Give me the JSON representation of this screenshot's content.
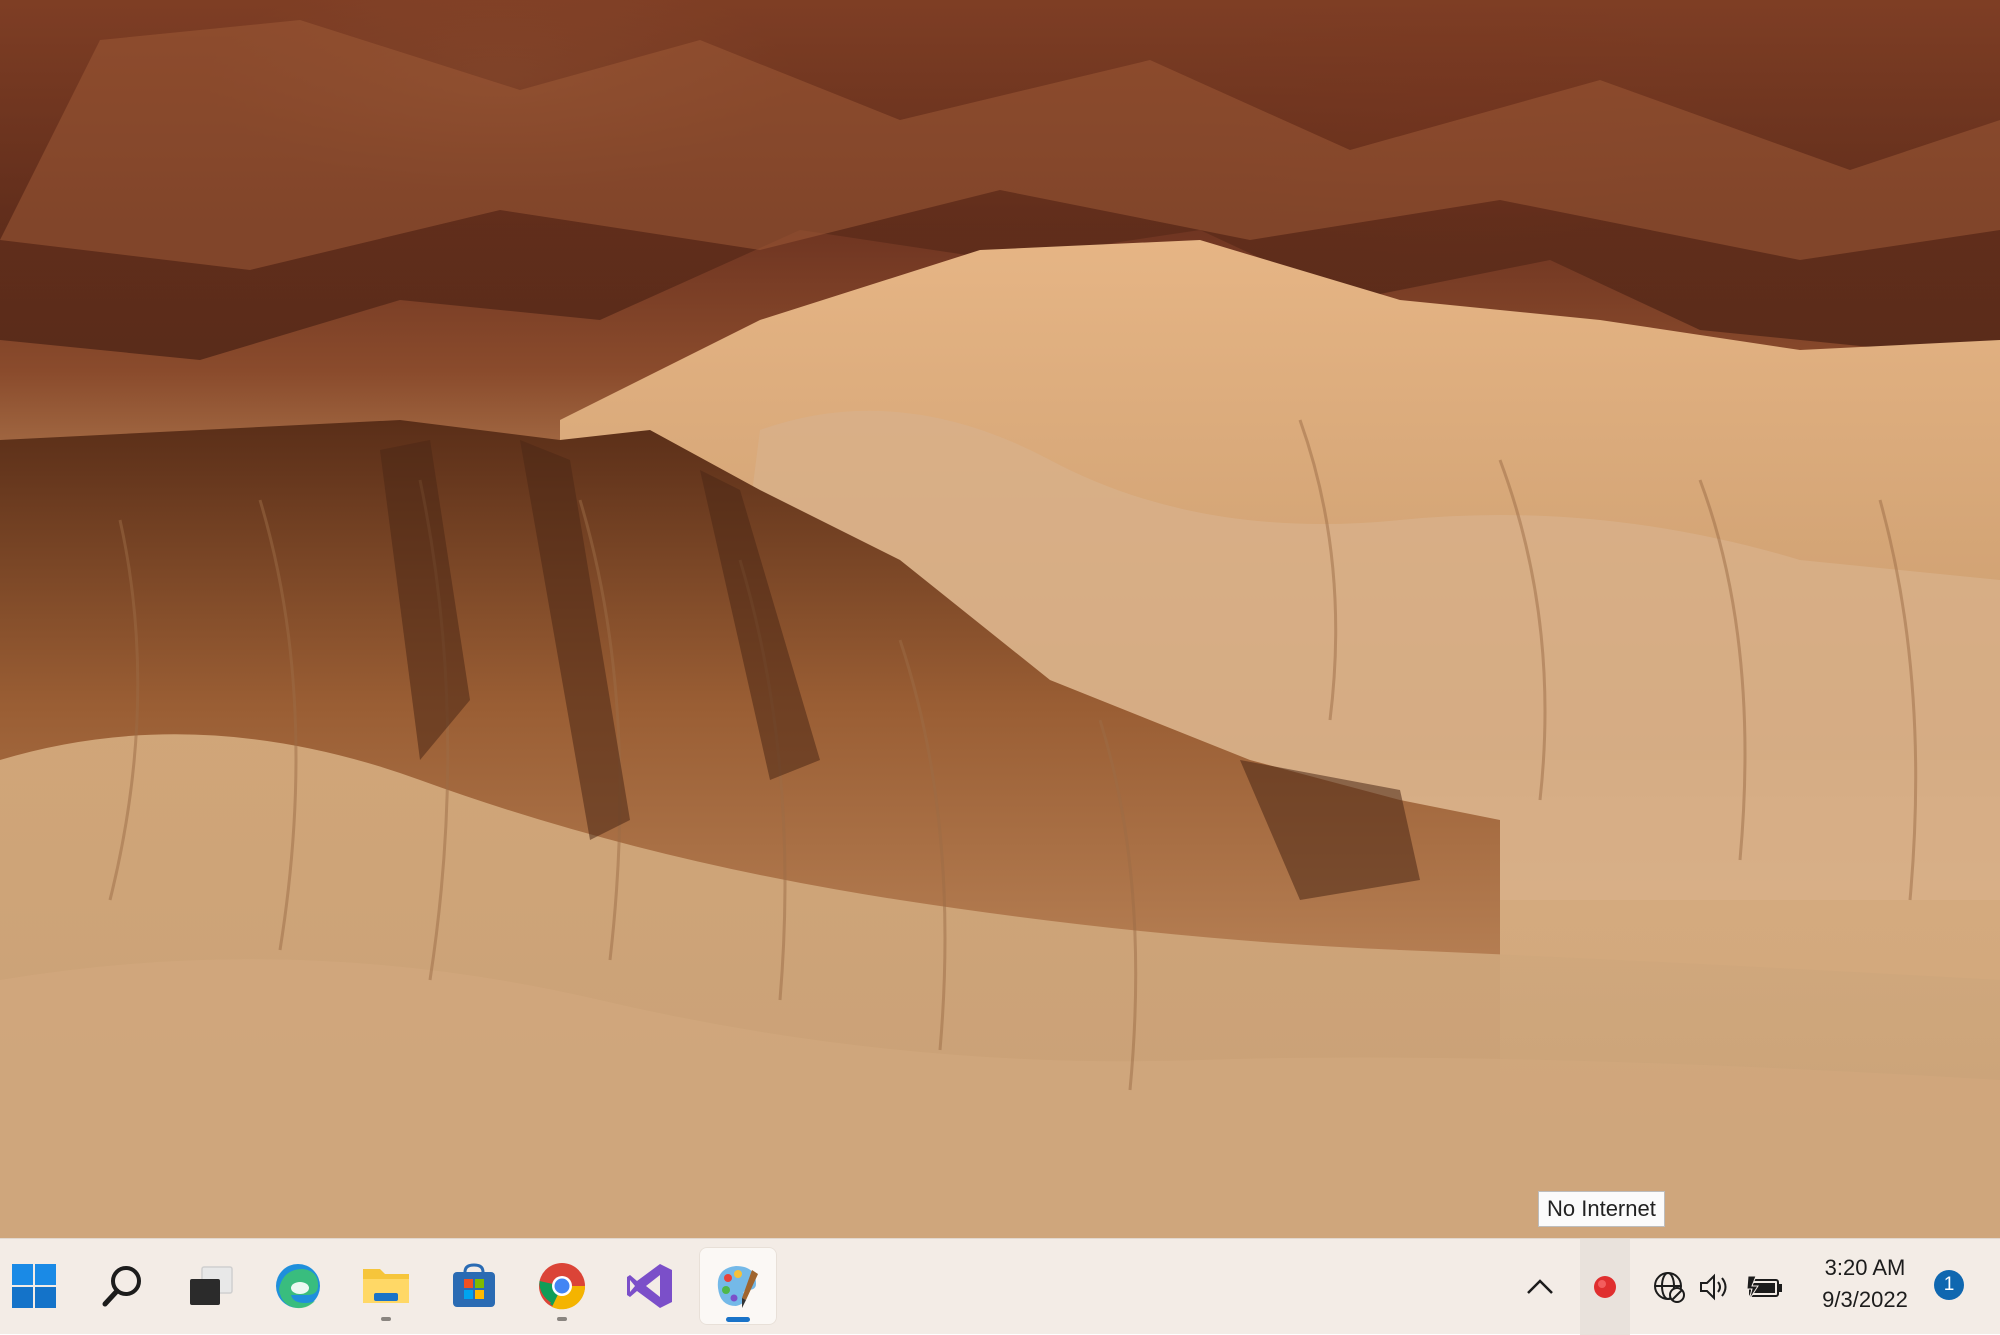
{
  "desktop": {
    "wallpaper": "desert-badlands"
  },
  "taskbar": {
    "apps": [
      {
        "name": "start-button",
        "icon": "windows-logo-icon",
        "running": false
      },
      {
        "name": "search-button",
        "icon": "search-icon",
        "running": false
      },
      {
        "name": "task-view-button",
        "icon": "task-view-icon",
        "running": false
      },
      {
        "name": "edge-button",
        "icon": "edge-icon",
        "running": false
      },
      {
        "name": "file-explorer-button",
        "icon": "folder-icon",
        "running": true
      },
      {
        "name": "microsoft-store-button",
        "icon": "store-icon",
        "running": false
      },
      {
        "name": "chrome-button",
        "icon": "chrome-icon",
        "running": true
      },
      {
        "name": "visual-studio-button",
        "icon": "visual-studio-icon",
        "running": false
      },
      {
        "name": "paint-button",
        "icon": "paint-icon",
        "running": true,
        "active": true
      }
    ],
    "accent_color": "#1a73c8"
  },
  "tray": {
    "show_hidden_icon": "chevron-up-icon",
    "recording_icon": "red-dot-icon",
    "network_icon": "globe-no-internet-icon",
    "volume_icon": "speaker-icon",
    "battery_icon": "battery-charging-icon",
    "tooltip": "No Internet",
    "time": "3:20 AM",
    "date": "9/3/2022",
    "notification_count": "1"
  }
}
